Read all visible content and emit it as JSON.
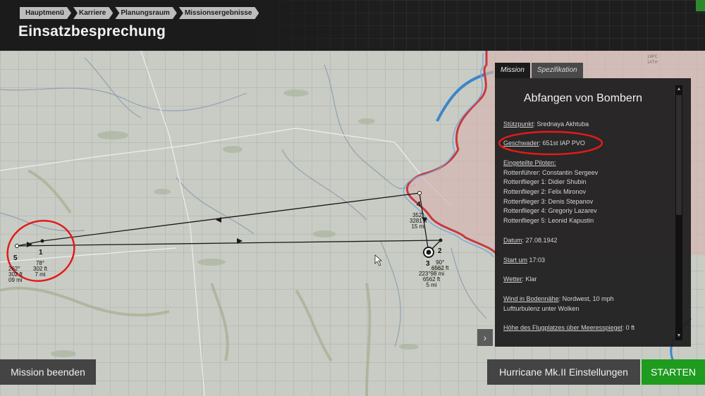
{
  "breadcrumb": [
    "Hauptmenü",
    "Karriere",
    "Planungsraum",
    "Missionsergebnisse"
  ],
  "page_title": "Einsatzbesprechung",
  "corner_badge": "",
  "tabs": {
    "mission": "Mission",
    "spec": "Spezifikation"
  },
  "mission": {
    "title": "Abfangen von Bombern",
    "base_label": "Stützpunkt",
    "base_value": ": Srednaya Akhtuba",
    "squadron_label": "Geschwader",
    "squadron_value": ": 651st IAP PVO",
    "pilots_label": "Eingeteilte Piloten:",
    "pilots": [
      "Rottenführer: Constantin Sergeev",
      "Rottenflieger 1: Didier Shubin",
      "Rottenflieger 2: Felix Mironov",
      "Rottenflieger 3: Denis Stepanov",
      "Rottenflieger 4: Gregoriy Lazarev",
      "Rottenflieger 5: Leonid Kapustin"
    ],
    "date_label": "Datum",
    "date_value": ": 27.08.1942",
    "start_label": "Start um",
    "start_value": " 17:03",
    "weather_label": "Wetter",
    "weather_value": ": Klar",
    "wind_label": "Wind in Bodennähe",
    "wind_value": ": Nordwest, 10 mph",
    "turbulence": "Luftturbulenz unter Wolken",
    "elevation_label": "Höhe des Flugplatzes über Meeresspiegel",
    "elevation_value": ": 0 ft"
  },
  "waypoints": {
    "wp1": {
      "num": "1",
      "label": "78°\n302 ft\n7 mi"
    },
    "wp2": {
      "num": "2",
      "label": "90°\n6562 ft"
    },
    "wp3": {
      "num": "3",
      "label": "223°98 mi\n6562 ft\n5 mi"
    },
    "wp4": {
      "num": "4",
      "label": "352°\n3281 ft\n15 mi"
    },
    "wp5": {
      "num": "5",
      "label": "262°\n302 ft\n09 mi"
    }
  },
  "map_labels": {
    "top_right_1": "18PC",
    "top_right_2": "14TH"
  },
  "buttons": {
    "end": "Mission beenden",
    "settings": "Hurricane Mk.II Einstellungen",
    "start": "STARTEN"
  },
  "colors": {
    "start_green": "#1f9b1f",
    "annotation_red": "#e21b1b",
    "frontline_red": "#c9393d",
    "river_blue": "#3b86c9"
  }
}
